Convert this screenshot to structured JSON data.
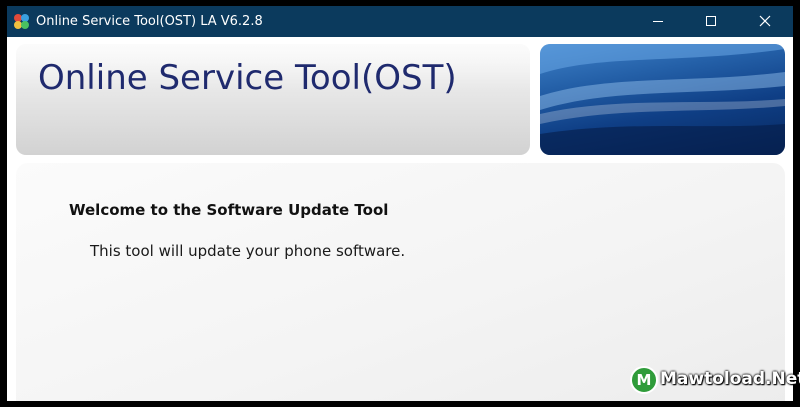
{
  "window": {
    "title": "Online Service Tool(OST) LA V6.2.8",
    "app_icon": "ost-app-icon",
    "titlebar_color": "#0b3a5d",
    "controls": {
      "minimize": "minimize-icon",
      "maximize": "maximize-icon",
      "close": "close-icon"
    }
  },
  "banner": {
    "title": "Online Service Tool(OST)",
    "title_color": "#1f2a6e",
    "art_accent": "#2460a8"
  },
  "content": {
    "heading": "Welcome to the Software Update Tool",
    "body": "This tool will update your phone software."
  },
  "watermark": {
    "logo_letter": "M",
    "text": "Mawtoload.Net",
    "logo_color": "#2f9c3a"
  }
}
